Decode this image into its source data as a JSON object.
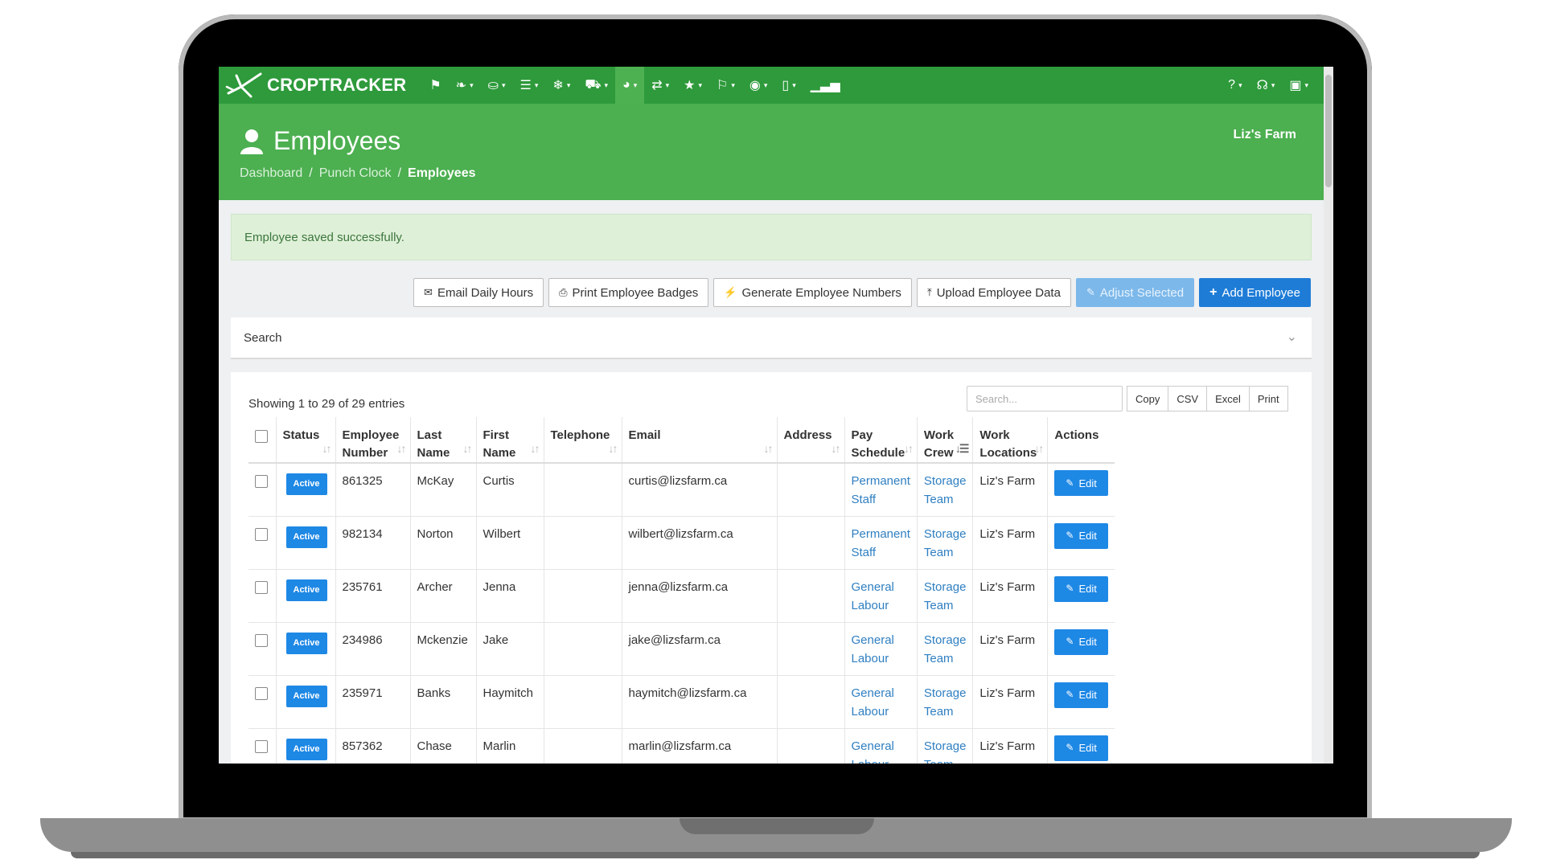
{
  "nav": {
    "brand": "CROPTRACKER",
    "items": [
      {
        "icon": "bookmark-icon",
        "glyph": "⚑",
        "caret": ""
      },
      {
        "icon": "leaf-icon",
        "glyph": "❧",
        "caret": "▾"
      },
      {
        "icon": "basket-icon",
        "glyph": "⛀",
        "caret": "▾"
      },
      {
        "icon": "ledger-icon",
        "glyph": "☰",
        "caret": "▾"
      },
      {
        "icon": "snowflake-icon",
        "glyph": "❄",
        "caret": "▾"
      },
      {
        "icon": "truck-icon",
        "glyph": "⛟",
        "caret": "▾"
      },
      {
        "icon": "user-icon",
        "glyph": "◕",
        "caret": "▾"
      },
      {
        "icon": "transfer-icon",
        "glyph": "⇄",
        "caret": "▾"
      },
      {
        "icon": "award-icon",
        "glyph": "★",
        "caret": "▾"
      },
      {
        "icon": "flag-icon",
        "glyph": "⚐",
        "caret": "▾"
      },
      {
        "icon": "lightbulb-icon",
        "glyph": "◉",
        "caret": "▾"
      },
      {
        "icon": "mobile-icon",
        "glyph": "▯",
        "caret": "▾"
      },
      {
        "icon": "bar-chart-icon",
        "glyph": "▁▃▅",
        "caret": ""
      }
    ],
    "right_items": [
      {
        "icon": "help-icon",
        "glyph": "?",
        "caret": "▾"
      },
      {
        "icon": "headset-icon",
        "glyph": "☊",
        "caret": "▾"
      },
      {
        "icon": "briefcase-icon",
        "glyph": "▣",
        "caret": "▾"
      }
    ]
  },
  "header": {
    "title": "Employees",
    "farm": "Liz's Farm",
    "breadcrumb": [
      "Dashboard",
      "Punch Clock",
      "Employees"
    ]
  },
  "alert": "Employee saved successfully.",
  "toolbar": {
    "email_daily_hours": "Email Daily Hours",
    "print_badges": "Print Employee Badges",
    "generate_numbers": "Generate Employee Numbers",
    "upload_data": "Upload Employee Data",
    "adjust_selected": "Adjust Selected",
    "add_employee": "Add Employee"
  },
  "search_panel": {
    "label": "Search"
  },
  "table": {
    "info": "Showing 1 to 29 of 29 entries",
    "search_placeholder": "Search...",
    "export_buttons": [
      "Copy",
      "CSV",
      "Excel",
      "Print"
    ],
    "columns": [
      {
        "l1": "Status",
        "l2": ""
      },
      {
        "l1": "Employee",
        "l2": "Number"
      },
      {
        "l1": "Last",
        "l2": "Name"
      },
      {
        "l1": "First",
        "l2": "Name"
      },
      {
        "l1": "Telephone",
        "l2": ""
      },
      {
        "l1": "Email",
        "l2": ""
      },
      {
        "l1": "Address",
        "l2": ""
      },
      {
        "l1": "Pay",
        "l2": "Schedule"
      },
      {
        "l1": "Work",
        "l2": "Crew"
      },
      {
        "l1": "Work",
        "l2": "Locations"
      },
      {
        "l1": "Actions",
        "l2": ""
      }
    ],
    "edit_label": "Edit",
    "rows": [
      {
        "status": "Active",
        "number": "861325",
        "last": "McKay",
        "first": "Curtis",
        "telephone": "",
        "email": "curtis@lizsfarm.ca",
        "address": "",
        "pay": [
          "Permanent",
          "Staff"
        ],
        "crew": [
          "Storage",
          "Team"
        ],
        "location": "Liz's Farm"
      },
      {
        "status": "Active",
        "number": "982134",
        "last": "Norton",
        "first": "Wilbert",
        "telephone": "",
        "email": "wilbert@lizsfarm.ca",
        "address": "",
        "pay": [
          "Permanent",
          "Staff"
        ],
        "crew": [
          "Storage",
          "Team"
        ],
        "location": "Liz's Farm"
      },
      {
        "status": "Active",
        "number": "235761",
        "last": "Archer",
        "first": "Jenna",
        "telephone": "",
        "email": "jenna@lizsfarm.ca",
        "address": "",
        "pay": [
          "General",
          "Labour"
        ],
        "crew": [
          "Storage",
          "Team"
        ],
        "location": "Liz's Farm"
      },
      {
        "status": "Active",
        "number": "234986",
        "last": "Mckenzie",
        "first": "Jake",
        "telephone": "",
        "email": "jake@lizsfarm.ca",
        "address": "",
        "pay": [
          "General",
          "Labour"
        ],
        "crew": [
          "Storage",
          "Team"
        ],
        "location": "Liz's Farm"
      },
      {
        "status": "Active",
        "number": "235971",
        "last": "Banks",
        "first": "Haymitch",
        "telephone": "",
        "email": "haymitch@lizsfarm.ca",
        "address": "",
        "pay": [
          "General",
          "Labour"
        ],
        "crew": [
          "Storage",
          "Team"
        ],
        "location": "Liz's Farm"
      },
      {
        "status": "Active",
        "number": "857362",
        "last": "Chase",
        "first": "Marlin",
        "telephone": "",
        "email": "marlin@lizsfarm.ca",
        "address": "",
        "pay": [
          "General",
          "Labour"
        ],
        "crew": [
          "Storage",
          "Team"
        ],
        "location": "Liz's Farm"
      }
    ]
  }
}
